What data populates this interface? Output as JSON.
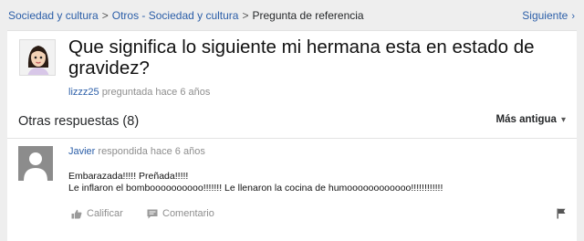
{
  "breadcrumb": {
    "items": [
      "Sociedad y cultura",
      "Otros - Sociedad y cultura",
      "Pregunta de referencia"
    ],
    "separator": ">",
    "next_label": "Siguiente"
  },
  "question": {
    "title": "Que significa lo siguiente mi hermana esta en estado de gravidez?",
    "author": "lizzz25",
    "meta": "preguntada hace 6 años"
  },
  "answers": {
    "header": "Otras respuestas (8)",
    "sort_label": "Más antigua",
    "items": [
      {
        "author": "Javier",
        "meta": "respondida hace 6 años",
        "lines": [
          "Embarazada!!!!! Preñada!!!!!",
          "Le inflaron el bomboooooooooo!!!!!!! Le llenaron la cocina de humoooooooooooo!!!!!!!!!!!!"
        ],
        "rate_label": "Calificar",
        "comment_label": "Comentario"
      }
    ]
  },
  "colors": {
    "link": "#2b5ea8",
    "meta": "#8e8e8e",
    "background": "#eeeeee"
  },
  "icons": [
    "chevron-right-icon",
    "chevron-down-icon",
    "thumbs-up-icon",
    "comment-icon",
    "flag-icon",
    "avatar-icon"
  ]
}
